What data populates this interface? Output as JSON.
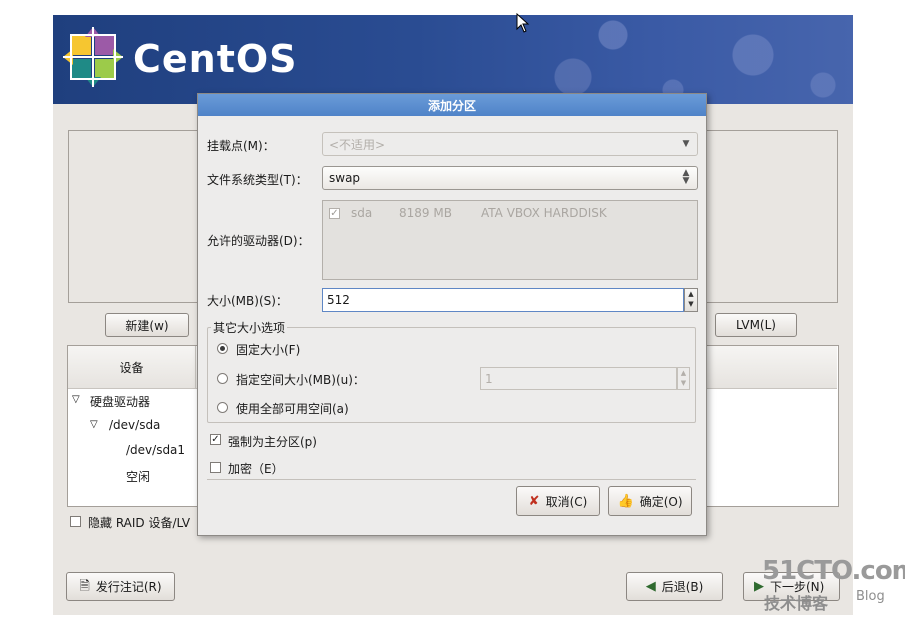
{
  "brand": {
    "name": "CentOS"
  },
  "main": {
    "new_label": "新建(w)",
    "lvm_label": "LVM(L)",
    "tree_header_device": "设备",
    "tree": [
      "硬盘驱动器",
      "/dev/sda",
      "/dev/sda1",
      "空闲"
    ],
    "hide_raid_label": "隐藏 RAID 设备/LV",
    "release_notes_label": "发行注记(R)",
    "back_label": "后退(B)",
    "next_label": "下一步(N)"
  },
  "dialog": {
    "title": "添加分区",
    "mount_label": "挂载点(M)：",
    "mount_value": "<不适用>",
    "fstype_label": "文件系统类型(T)：",
    "fstype_value": "swap",
    "drives_label": "允许的驱动器(D)：",
    "drive": {
      "name": "sda",
      "size": "8189 MB",
      "model": "ATA VBOX HARDDISK",
      "checked": true
    },
    "size_label": "大小(MB)(S)：",
    "size_value": "512",
    "options_title": "其它大小选项",
    "opt_fixed": "固定大小(F)",
    "opt_upto": "指定空间大小(MB)(u)：",
    "opt_upto_value": "1",
    "opt_fill": "使用全部可用空间(a)",
    "primary_label": "强制为主分区(p)",
    "primary_checked": true,
    "encrypt_label": "加密（E）",
    "cancel_label": "取消(C)",
    "ok_label": "确定(O)"
  },
  "watermark": {
    "site": "51CTO.com",
    "sub": "技术博客",
    "blog": "Blog"
  }
}
